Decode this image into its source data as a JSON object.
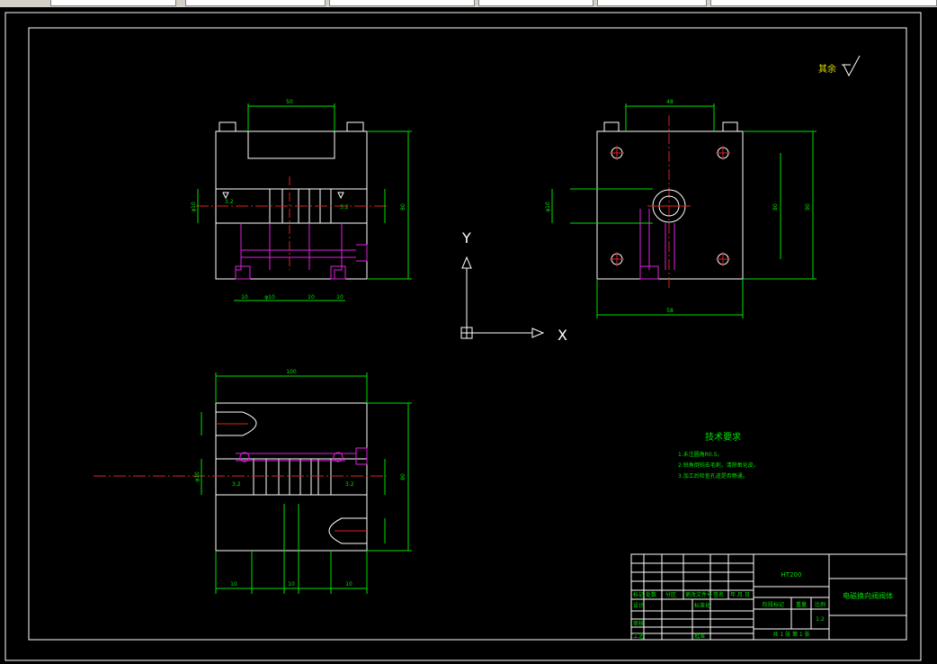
{
  "colors": {
    "background": "#000000",
    "outline": "#ffffff",
    "dimension": "#00e000",
    "centerline": "#e02020",
    "channel": "#e020e0",
    "tabbar": "#d4d0c8"
  },
  "tabbar": {
    "tabs": [
      "",
      "",
      "",
      "",
      "",
      ""
    ]
  },
  "drawing": {
    "surface_finish": "其余",
    "tech_req": {
      "title": "技术要求",
      "items": [
        "1.未注圆角R0.5。",
        "2.锐角倒钝去毛刺，清除氧化皮。",
        "3.加工后检查孔道是否畅通。"
      ]
    },
    "ucs": {
      "y_label": "Y",
      "x_label": "X"
    },
    "title_block": {
      "part_name": "电磁换向阀阀体",
      "material": "HT200",
      "scale": "1:2",
      "scale_label": "比例",
      "weight_label": "重量",
      "stage_label": "阶段标记",
      "sheets": "共 1 张   第 1 张",
      "designer": "设计",
      "standardize": "标准化",
      "reviewer": "审核",
      "process": "工艺",
      "approve": "批准",
      "mark": "标记",
      "count": "处数",
      "zone": "分区",
      "change_no": "更改文件号",
      "signature": "签名",
      "date": "年.月.日"
    },
    "dims": {
      "top_view_width": "50",
      "side_view_width": "48",
      "front_height": "80",
      "bottom_width": "100",
      "bottom_height": "80",
      "side_bottom": "58",
      "side_height": "90",
      "dim_small": "10",
      "bore": "φ10",
      "roughness": "3.2"
    }
  }
}
